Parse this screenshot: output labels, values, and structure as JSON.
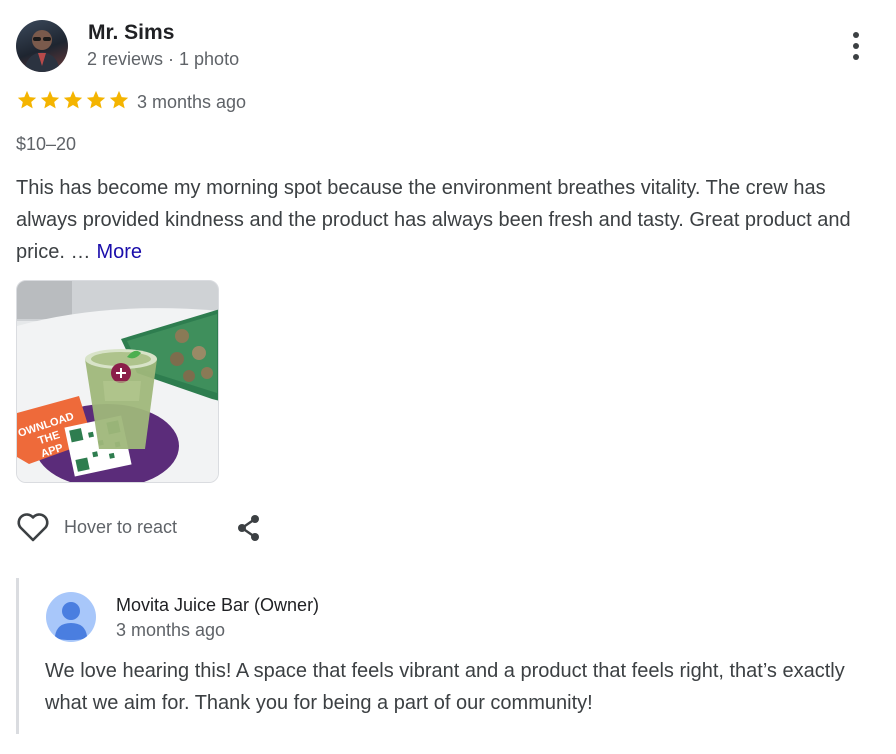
{
  "review": {
    "reviewer_name": "Mr. Sims",
    "reviewer_meta": "2 reviews · 1 photo",
    "rating": 5,
    "rating_max": 5,
    "date": "3 months ago",
    "price": "$10–20",
    "text": "This has become my morning spot because the environment breathes vitality. The crew has always provided kindness and the product has always been fresh and tasty. Great product and price. …",
    "more_label": "More",
    "photo_labels": {
      "line1": "OWNLOAD",
      "line2": "THE",
      "line3": "APP"
    },
    "colors": {
      "star": "#f4b400",
      "link": "#1a0dab"
    }
  },
  "actions": {
    "react_label": "Hover to react",
    "heart_icon": "heart-outline-icon",
    "share_icon": "share-icon",
    "menu_icon": "more-vertical-icon"
  },
  "owner_response": {
    "name": "Movita Juice Bar (Owner)",
    "date": "3 months ago",
    "text": "We love hearing this! A space that feels vibrant and a product that feels right, that’s exactly what we aim for. Thank you for being a part of our community!"
  }
}
